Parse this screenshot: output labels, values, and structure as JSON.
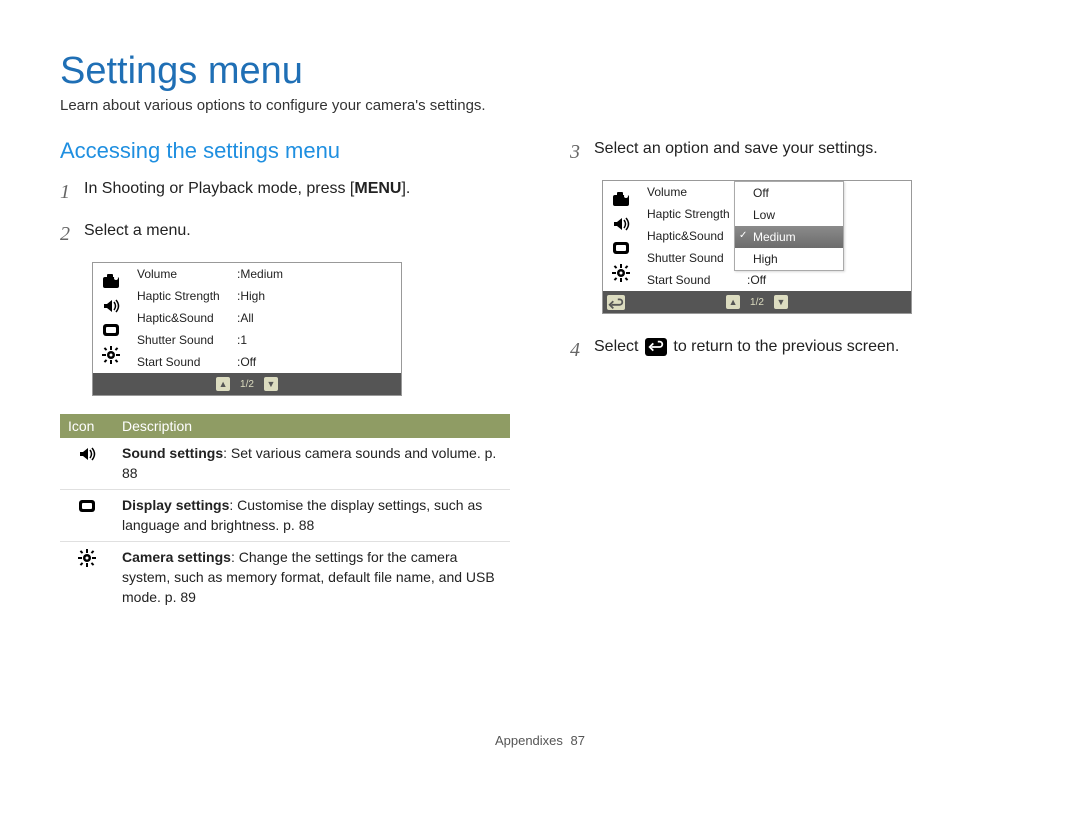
{
  "title": "Settings menu",
  "intro": "Learn about various options to configure your camera's settings.",
  "left": {
    "subhead": "Accessing the settings menu",
    "steps": [
      {
        "num": "1",
        "text_pre": "In Shooting or Playback mode, press [",
        "bold": "MENU",
        "text_post": "]."
      },
      {
        "num": "2",
        "text_pre": "Select a menu.",
        "bold": "",
        "text_post": ""
      }
    ],
    "lcd": {
      "rows": [
        {
          "label": "Volume",
          "value": "Medium"
        },
        {
          "label": "Haptic Strength",
          "value": "High"
        },
        {
          "label": "Haptic&Sound",
          "value": "All"
        },
        {
          "label": "Shutter Sound",
          "value": "1"
        },
        {
          "label": "Start Sound",
          "value": "Off"
        }
      ],
      "page": "1/2"
    },
    "table": {
      "head_icon": "Icon",
      "head_desc": "Description",
      "rows": [
        {
          "icon": "sound",
          "bold": "Sound settings",
          "rest": ": Set various camera sounds and volume. p. 88"
        },
        {
          "icon": "display",
          "bold": "Display settings",
          "rest": ": Customise the display settings, such as language and brightness. p. 88"
        },
        {
          "icon": "gear",
          "bold": "Camera settings",
          "rest": ": Change the settings for the camera system, such as memory format, default file name, and USB mode. p. 89"
        }
      ]
    }
  },
  "right": {
    "steps": [
      {
        "num": "3",
        "text": "Select an option and save your settings."
      },
      {
        "num": "4",
        "text_pre": "Select ",
        "text_post": " to return to the previous screen."
      }
    ],
    "lcd": {
      "rows": [
        {
          "label": "Volume",
          "value": ""
        },
        {
          "label": "Haptic Strength",
          "value": ""
        },
        {
          "label": "Haptic&Sound",
          "value": ""
        },
        {
          "label": "Shutter Sound",
          "value": ""
        },
        {
          "label": "Start Sound",
          "value": "Off"
        }
      ],
      "dropdown": [
        "Off",
        "Low",
        "Medium",
        "High"
      ],
      "selected": "Medium",
      "page": "1/2"
    }
  },
  "footer": {
    "section": "Appendixes",
    "page": "87"
  }
}
